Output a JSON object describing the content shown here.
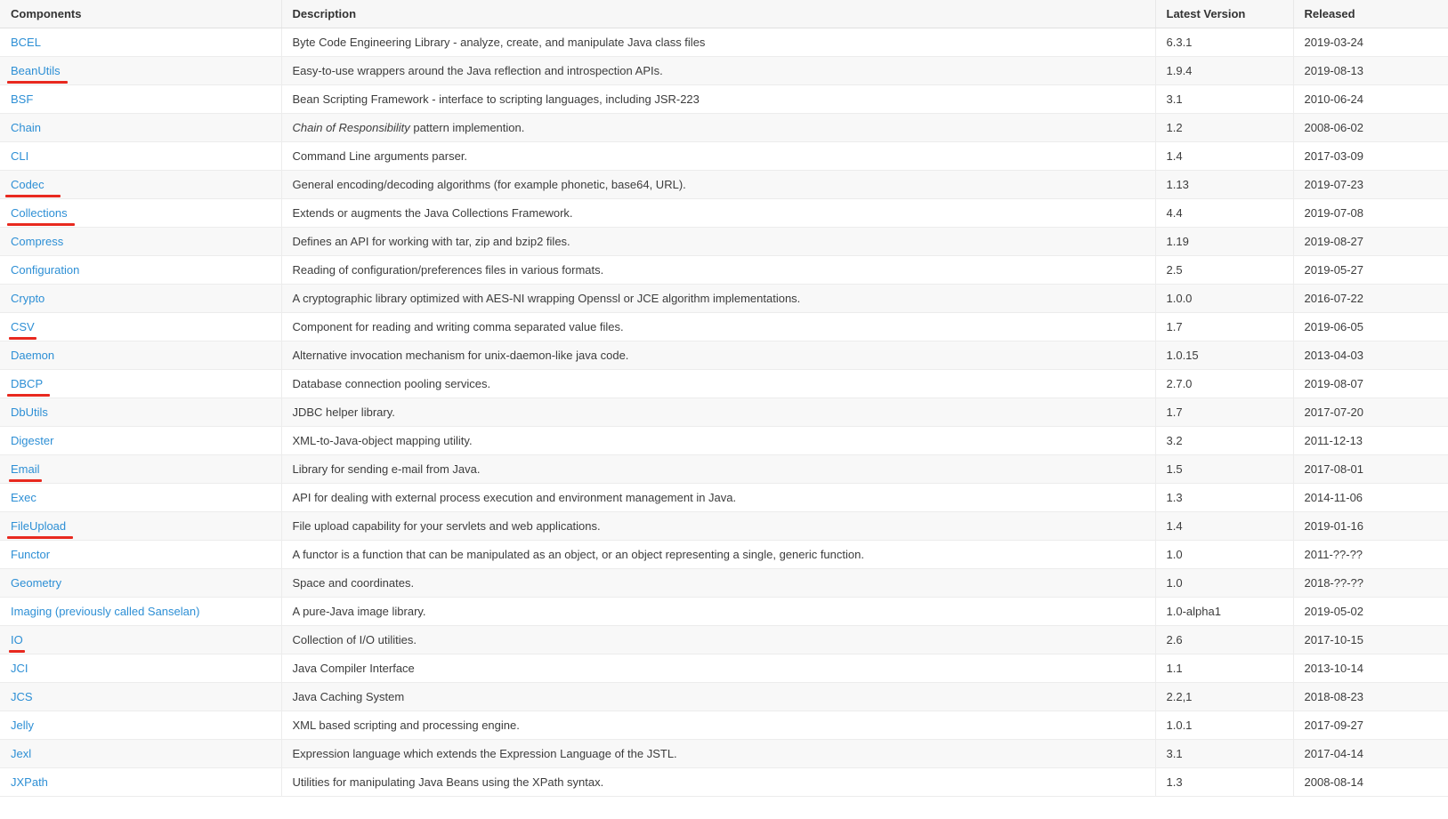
{
  "table": {
    "headers": {
      "components": "Components",
      "description": "Description",
      "version": "Latest Version",
      "released": "Released"
    },
    "rows": [
      {
        "component": "BCEL",
        "marked": false,
        "description": "Byte Code Engineering Library - analyze, create, and manipulate Java class files",
        "description_italic_prefix": "",
        "version": "6.3.1",
        "released": "2019-03-24"
      },
      {
        "component": "BeanUtils",
        "marked": true,
        "description": "Easy-to-use wrappers around the Java reflection and introspection APIs.",
        "description_italic_prefix": "",
        "version": "1.9.4",
        "released": "2019-08-13"
      },
      {
        "component": "BSF",
        "marked": false,
        "description": "Bean Scripting Framework - interface to scripting languages, including JSR-223",
        "description_italic_prefix": "",
        "version": "3.1",
        "released": "2010-06-24"
      },
      {
        "component": "Chain",
        "marked": false,
        "description": " pattern implemention.",
        "description_italic_prefix": "Chain of Responsibility",
        "version": "1.2",
        "released": "2008-06-02"
      },
      {
        "component": "CLI",
        "marked": false,
        "description": "Command Line arguments parser.",
        "description_italic_prefix": "",
        "version": "1.4",
        "released": "2017-03-09"
      },
      {
        "component": "Codec",
        "marked": true,
        "description": "General encoding/decoding algorithms (for example phonetic, base64, URL).",
        "description_italic_prefix": "",
        "version": "1.13",
        "released": "2019-07-23"
      },
      {
        "component": "Collections",
        "marked": true,
        "description": "Extends or augments the Java Collections Framework.",
        "description_italic_prefix": "",
        "version": "4.4",
        "released": "2019-07-08"
      },
      {
        "component": "Compress",
        "marked": false,
        "description": "Defines an API for working with tar, zip and bzip2 files.",
        "description_italic_prefix": "",
        "version": "1.19",
        "released": "2019-08-27"
      },
      {
        "component": "Configuration",
        "marked": false,
        "description": "Reading of configuration/preferences files in various formats.",
        "description_italic_prefix": "",
        "version": "2.5",
        "released": "2019-05-27"
      },
      {
        "component": "Crypto",
        "marked": false,
        "description": "A cryptographic library optimized with AES-NI wrapping Openssl or JCE algorithm implementations.",
        "description_italic_prefix": "",
        "version": "1.0.0",
        "released": "2016-07-22"
      },
      {
        "component": "CSV",
        "marked": true,
        "description": "Component for reading and writing comma separated value files.",
        "description_italic_prefix": "",
        "version": "1.7",
        "released": "2019-06-05"
      },
      {
        "component": "Daemon",
        "marked": false,
        "description": "Alternative invocation mechanism for unix-daemon-like java code.",
        "description_italic_prefix": "",
        "version": "1.0.15",
        "released": "2013-04-03"
      },
      {
        "component": "DBCP",
        "marked": true,
        "description": "Database connection pooling services.",
        "description_italic_prefix": "",
        "version": "2.7.0",
        "released": "2019-08-07"
      },
      {
        "component": "DbUtils",
        "marked": false,
        "description": "JDBC helper library.",
        "description_italic_prefix": "",
        "version": "1.7",
        "released": "2017-07-20"
      },
      {
        "component": "Digester",
        "marked": false,
        "description": "XML-to-Java-object mapping utility.",
        "description_italic_prefix": "",
        "version": "3.2",
        "released": "2011-12-13"
      },
      {
        "component": "Email",
        "marked": true,
        "description": "Library for sending e-mail from Java.",
        "description_italic_prefix": "",
        "version": "1.5",
        "released": "2017-08-01"
      },
      {
        "component": "Exec",
        "marked": false,
        "description": "API for dealing with external process execution and environment management in Java.",
        "description_italic_prefix": "",
        "version": "1.3",
        "released": "2014-11-06"
      },
      {
        "component": "FileUpload",
        "marked": true,
        "description": "File upload capability for your servlets and web applications.",
        "description_italic_prefix": "",
        "version": "1.4",
        "released": "2019-01-16"
      },
      {
        "component": "Functor",
        "marked": false,
        "description": "A functor is a function that can be manipulated as an object, or an object representing a single, generic function.",
        "description_italic_prefix": "",
        "version": "1.0",
        "released": "2011-??-??"
      },
      {
        "component": "Geometry",
        "marked": false,
        "description": "Space and coordinates.",
        "description_italic_prefix": "",
        "version": "1.0",
        "released": "2018-??-??"
      },
      {
        "component": "Imaging (previously called Sanselan)",
        "marked": false,
        "description": "A pure-Java image library.",
        "description_italic_prefix": "",
        "version": "1.0-alpha1",
        "released": "2019-05-02"
      },
      {
        "component": "IO",
        "marked": true,
        "description": "Collection of I/O utilities.",
        "description_italic_prefix": "",
        "version": "2.6",
        "released": "2017-10-15"
      },
      {
        "component": "JCI",
        "marked": false,
        "description": "Java Compiler Interface",
        "description_italic_prefix": "",
        "version": "1.1",
        "released": "2013-10-14"
      },
      {
        "component": "JCS",
        "marked": false,
        "description": "Java Caching System",
        "description_italic_prefix": "",
        "version": "2.2,1",
        "released": "2018-08-23"
      },
      {
        "component": "Jelly",
        "marked": false,
        "description": "XML based scripting and processing engine.",
        "description_italic_prefix": "",
        "version": "1.0.1",
        "released": "2017-09-27"
      },
      {
        "component": "Jexl",
        "marked": false,
        "description": "Expression language which extends the Expression Language of the JSTL.",
        "description_italic_prefix": "",
        "version": "3.1",
        "released": "2017-04-14"
      },
      {
        "component": "JXPath",
        "marked": false,
        "description": "Utilities for manipulating Java Beans using the XPath syntax.",
        "description_italic_prefix": "",
        "version": "1.3",
        "released": "2008-08-14"
      }
    ]
  },
  "colors": {
    "link": "#2d8fd5",
    "highlight_underline": "#e8291f",
    "header_background": "#f7f7f7",
    "row_even_background": "#f8f8f8",
    "row_odd_background": "#ffffff",
    "border": "#ececec",
    "text": "#3c3c3c"
  }
}
